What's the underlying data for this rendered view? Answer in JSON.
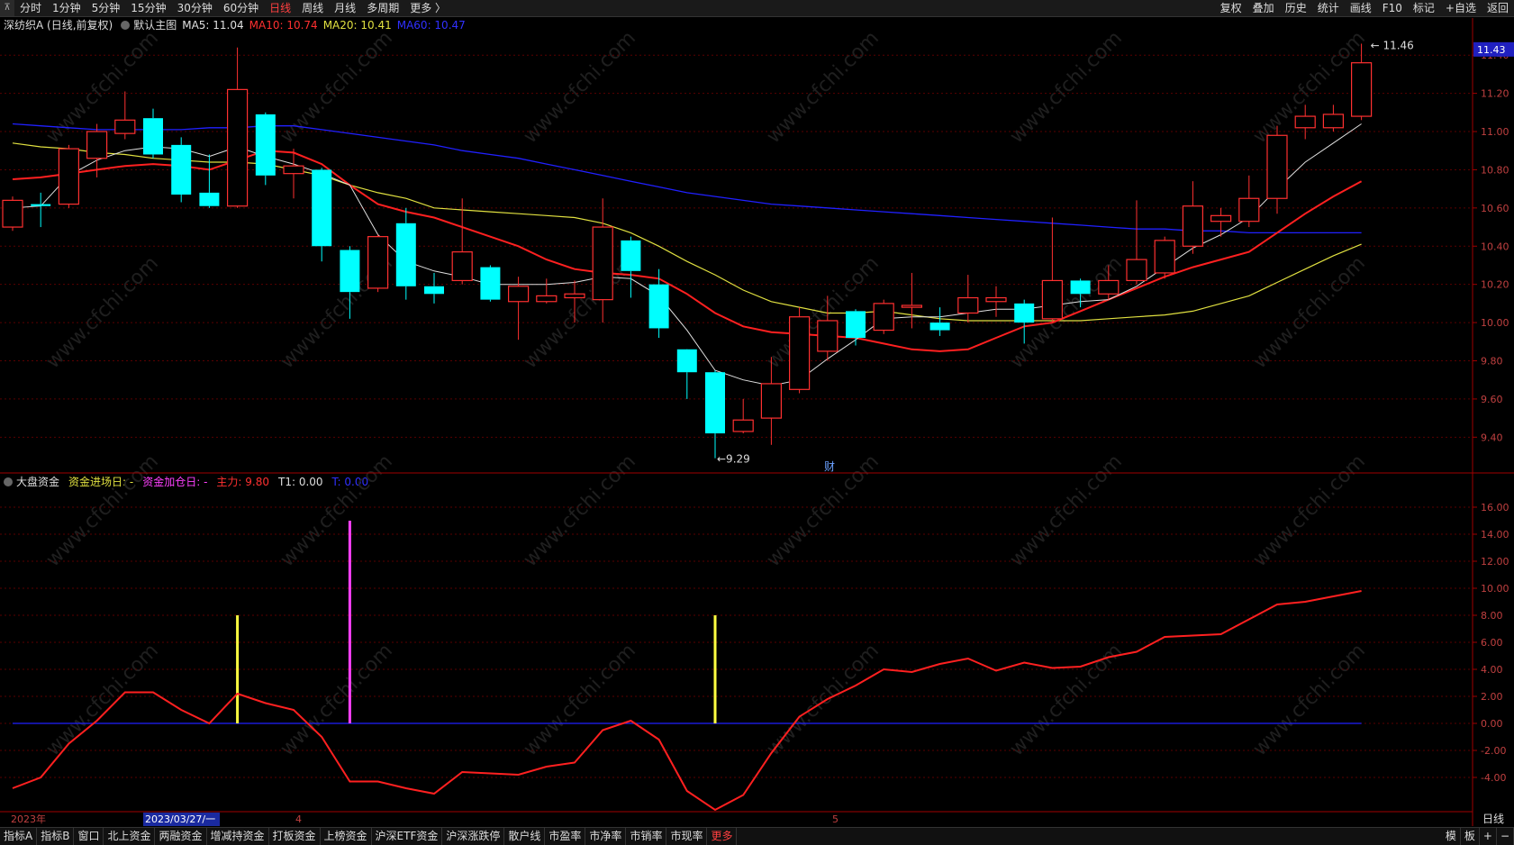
{
  "toolbar": {
    "corner": "⊼",
    "left": [
      "分时",
      "1分钟",
      "5分钟",
      "15分钟",
      "30分钟",
      "60分钟",
      "日线",
      "周线",
      "月线",
      "多周期",
      "更多 〉"
    ],
    "active": "日线",
    "right": [
      "复权",
      "叠加",
      "历史",
      "统计",
      "画线",
      "F10",
      "标记",
      "+自选",
      "返回"
    ]
  },
  "info": {
    "stock": "深纺织A (日线,前复权)",
    "template": "默认主图",
    "ma5": "MA5: 11.04",
    "ma10": "MA10: 10.74",
    "ma20": "MA20: 10.41",
    "ma60": "MA60: 10.47"
  },
  "indicator": {
    "name": "大盘资金",
    "label1": "资金进场日: -",
    "label2": "资金加仓日: -",
    "main": "主力: 9.80",
    "t1": "T1: 0.00",
    "t": "T: 0.00"
  },
  "main_axis": {
    "ticks": [
      "11.40",
      "11.20",
      "11.00",
      "10.80",
      "10.60",
      "10.40",
      "10.20",
      "10.00",
      "9.80",
      "9.60",
      "9.40"
    ],
    "current": "11.43",
    "high_label": "11.46",
    "low_label": "9.29",
    "marker": "财"
  },
  "sub_axis": {
    "ticks": [
      "16.00",
      "14.00",
      "12.00",
      "10.00",
      "8.00",
      "6.00",
      "4.00",
      "2.00",
      "0.00",
      "-2.00",
      "-4.00"
    ]
  },
  "date_axis": {
    "year": "2023年",
    "cursor_date": "2023/03/27/一",
    "m4": "4",
    "m5": "5",
    "period": "日线"
  },
  "watermark": "www.cfchi.com",
  "colors": {
    "up": "#ff3030",
    "down": "#00ffff",
    "ma5": "#e0e0e0",
    "ma10": "#ff2020",
    "ma20": "#e0e040",
    "ma60": "#2020ff",
    "fund": "#ff2020",
    "yellow_bar": "#ffff40",
    "magenta_bar": "#ff40ff"
  },
  "bottom": {
    "left": [
      "指标A",
      "指标B",
      "窗口",
      "北上资金",
      "两融资金",
      "增减持资金",
      "打板资金",
      "上榜资金",
      "沪深ETF资金",
      "沪深涨跌停",
      "散户线",
      "市盈率",
      "市净率",
      "市销率",
      "市现率",
      "更多"
    ],
    "active": "更多",
    "right": [
      "模",
      "板",
      "+",
      "−"
    ]
  },
  "chart_data": [
    {
      "type": "candlestick",
      "title": "深纺织A (日线,前复权)",
      "candles": [
        {
          "o": 10.5,
          "c": 10.64,
          "h": 10.66,
          "l": 10.48
        },
        {
          "o": 10.62,
          "c": 10.61,
          "h": 10.68,
          "l": 10.5
        },
        {
          "o": 10.62,
          "c": 10.91,
          "h": 10.93,
          "l": 10.6
        },
        {
          "o": 10.86,
          "c": 11.0,
          "h": 11.04,
          "l": 10.76
        },
        {
          "o": 10.99,
          "c": 11.06,
          "h": 11.21,
          "l": 10.96
        },
        {
          "o": 11.07,
          "c": 10.88,
          "h": 11.12,
          "l": 10.86
        },
        {
          "o": 10.93,
          "c": 10.67,
          "h": 10.97,
          "l": 10.63
        },
        {
          "o": 10.68,
          "c": 10.61,
          "h": 10.88,
          "l": 10.6
        },
        {
          "o": 10.61,
          "c": 11.22,
          "h": 11.44,
          "l": 10.6
        },
        {
          "o": 11.09,
          "c": 10.77,
          "h": 11.1,
          "l": 10.72
        },
        {
          "o": 10.78,
          "c": 10.82,
          "h": 10.91,
          "l": 10.65
        },
        {
          "o": 10.8,
          "c": 10.4,
          "h": 10.81,
          "l": 10.32
        },
        {
          "o": 10.38,
          "c": 10.16,
          "h": 10.4,
          "l": 10.02
        },
        {
          "o": 10.18,
          "c": 10.45,
          "h": 10.46,
          "l": 10.16
        },
        {
          "o": 10.52,
          "c": 10.19,
          "h": 10.6,
          "l": 10.12
        },
        {
          "o": 10.19,
          "c": 10.15,
          "h": 10.26,
          "l": 10.1
        },
        {
          "o": 10.22,
          "c": 10.37,
          "h": 10.65,
          "l": 10.2
        },
        {
          "o": 10.29,
          "c": 10.12,
          "h": 10.3,
          "l": 10.11
        },
        {
          "o": 10.11,
          "c": 10.19,
          "h": 10.24,
          "l": 9.91
        },
        {
          "o": 10.11,
          "c": 10.14,
          "h": 10.23,
          "l": 10.1
        },
        {
          "o": 10.13,
          "c": 10.15,
          "h": 10.22,
          "l": 10.0
        },
        {
          "o": 10.12,
          "c": 10.5,
          "h": 10.65,
          "l": 10.0
        },
        {
          "o": 10.43,
          "c": 10.27,
          "h": 10.45,
          "l": 10.13
        },
        {
          "o": 10.2,
          "c": 9.97,
          "h": 10.28,
          "l": 9.92
        },
        {
          "o": 9.86,
          "c": 9.74,
          "h": 9.85,
          "l": 9.6
        },
        {
          "o": 9.74,
          "c": 9.42,
          "h": 9.75,
          "l": 9.29
        },
        {
          "o": 9.43,
          "c": 9.49,
          "h": 9.6,
          "l": 9.42
        },
        {
          "o": 9.5,
          "c": 9.68,
          "h": 9.82,
          "l": 9.36
        },
        {
          "o": 9.65,
          "c": 10.03,
          "h": 10.08,
          "l": 9.63
        },
        {
          "o": 9.85,
          "c": 10.01,
          "h": 10.14,
          "l": 9.8
        },
        {
          "o": 10.06,
          "c": 9.92,
          "h": 10.07,
          "l": 9.88
        },
        {
          "o": 9.96,
          "c": 10.1,
          "h": 10.12,
          "l": 9.94
        },
        {
          "o": 10.08,
          "c": 10.09,
          "h": 10.26,
          "l": 9.97
        },
        {
          "o": 10.0,
          "c": 9.96,
          "h": 10.08,
          "l": 9.93
        },
        {
          "o": 10.05,
          "c": 10.13,
          "h": 10.25,
          "l": 10.0
        },
        {
          "o": 10.11,
          "c": 10.13,
          "h": 10.19,
          "l": 10.03
        },
        {
          "o": 10.1,
          "c": 10.0,
          "h": 10.12,
          "l": 9.89
        },
        {
          "o": 10.02,
          "c": 10.22,
          "h": 10.55,
          "l": 10.0
        },
        {
          "o": 10.22,
          "c": 10.15,
          "h": 10.23,
          "l": 10.08
        },
        {
          "o": 10.15,
          "c": 10.22,
          "h": 10.3,
          "l": 10.12
        },
        {
          "o": 10.22,
          "c": 10.33,
          "h": 10.64,
          "l": 10.2
        },
        {
          "o": 10.26,
          "c": 10.43,
          "h": 10.45,
          "l": 10.23
        },
        {
          "o": 10.4,
          "c": 10.61,
          "h": 10.74,
          "l": 10.36
        },
        {
          "o": 10.53,
          "c": 10.56,
          "h": 10.6,
          "l": 10.45
        },
        {
          "o": 10.53,
          "c": 10.65,
          "h": 10.77,
          "l": 10.5
        },
        {
          "o": 10.65,
          "c": 10.98,
          "h": 11.03,
          "l": 10.57
        },
        {
          "o": 11.02,
          "c": 11.08,
          "h": 11.14,
          "l": 10.96
        },
        {
          "o": 11.02,
          "c": 11.09,
          "h": 11.14,
          "l": 11.0
        },
        {
          "o": 11.08,
          "c": 11.36,
          "h": 11.46,
          "l": 11.06
        }
      ],
      "ma5": [
        10.6,
        10.61,
        10.77,
        10.85,
        10.9,
        10.92,
        10.91,
        10.87,
        10.92,
        10.87,
        10.83,
        10.78,
        10.72,
        10.46,
        10.32,
        10.27,
        10.24,
        10.2,
        10.2,
        10.2,
        10.21,
        10.24,
        10.23,
        10.14,
        9.96,
        9.75,
        9.7,
        9.67,
        9.7,
        9.81,
        9.91,
        10.02,
        10.03,
        10.03,
        10.05,
        10.07,
        10.07,
        10.09,
        10.11,
        10.12,
        10.19,
        10.29,
        10.39,
        10.46,
        10.55,
        10.7,
        10.84,
        10.94,
        11.04
      ],
      "ma10": [
        10.75,
        10.76,
        10.78,
        10.8,
        10.82,
        10.83,
        10.82,
        10.8,
        10.85,
        10.9,
        10.89,
        10.83,
        10.72,
        10.62,
        10.58,
        10.55,
        10.5,
        10.45,
        10.4,
        10.33,
        10.28,
        10.26,
        10.25,
        10.23,
        10.15,
        10.05,
        9.98,
        9.95,
        9.94,
        9.93,
        9.92,
        9.89,
        9.86,
        9.85,
        9.86,
        9.92,
        9.98,
        10.0,
        10.06,
        10.12,
        10.18,
        10.24,
        10.29,
        10.33,
        10.37,
        10.47,
        10.57,
        10.66,
        10.74
      ],
      "ma20": [
        10.94,
        10.92,
        10.91,
        10.89,
        10.88,
        10.86,
        10.85,
        10.84,
        10.84,
        10.83,
        10.8,
        10.77,
        10.72,
        10.68,
        10.65,
        10.6,
        10.59,
        10.58,
        10.57,
        10.56,
        10.55,
        10.52,
        10.47,
        10.4,
        10.32,
        10.25,
        10.17,
        10.11,
        10.08,
        10.05,
        10.05,
        10.06,
        10.04,
        10.02,
        10.01,
        10.01,
        10.01,
        10.01,
        10.01,
        10.02,
        10.03,
        10.04,
        10.06,
        10.1,
        10.14,
        10.21,
        10.28,
        10.35,
        10.41
      ],
      "ma60": [
        11.04,
        11.03,
        11.02,
        11.01,
        11.01,
        11.01,
        11.01,
        11.02,
        11.02,
        11.03,
        11.03,
        11.01,
        10.99,
        10.97,
        10.95,
        10.93,
        10.9,
        10.88,
        10.86,
        10.83,
        10.8,
        10.77,
        10.74,
        10.71,
        10.68,
        10.66,
        10.64,
        10.62,
        10.61,
        10.6,
        10.59,
        10.58,
        10.57,
        10.56,
        10.55,
        10.54,
        10.53,
        10.52,
        10.51,
        10.5,
        10.49,
        10.49,
        10.48,
        10.48,
        10.47,
        10.47,
        10.47,
        10.47,
        10.47
      ]
    },
    {
      "type": "line",
      "title": "大盘资金",
      "series": [
        {
          "name": "主力",
          "values": [
            -4.8,
            -4.0,
            -1.5,
            0.2,
            2.3,
            2.3,
            1.0,
            0.0,
            2.2,
            1.5,
            1.0,
            -1.0,
            -4.3,
            -4.3,
            -4.8,
            -5.2,
            -3.6,
            -3.7,
            -3.8,
            -3.2,
            -2.9,
            -0.5,
            0.2,
            -1.2,
            -5.0,
            -6.4,
            -5.3,
            -2.2,
            0.5,
            1.8,
            2.8,
            4.0,
            3.8,
            4.4,
            4.8,
            3.9,
            4.5,
            4.1,
            4.2,
            4.9,
            5.3,
            6.4,
            6.5,
            6.6,
            7.7,
            8.8,
            9.0,
            9.4,
            9.8
          ]
        }
      ],
      "bars": [
        {
          "index": 8,
          "value": 8.0,
          "color": "yellow"
        },
        {
          "index": 12,
          "value": 15.0,
          "color": "magenta"
        },
        {
          "index": 25,
          "value": 8.0,
          "color": "yellow"
        }
      ],
      "baseline": 0.0
    }
  ]
}
